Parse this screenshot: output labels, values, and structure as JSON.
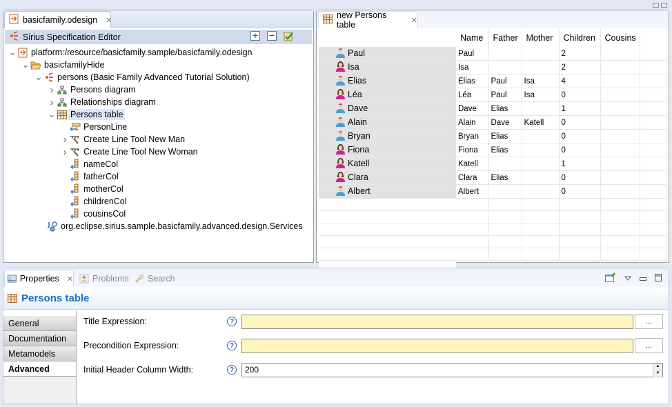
{
  "left_editor": {
    "tab_label": "basicfamily.odesign",
    "header_title": "Sirius Specification Editor",
    "tools": [
      {
        "name": "expand-all",
        "icon": "plus-box-icon"
      },
      {
        "name": "collapse-all",
        "icon": "minus-box-icon"
      },
      {
        "name": "validate",
        "icon": "validate-check-icon"
      }
    ],
    "tree": [
      {
        "label": "platform:/resource/basicfamily.sample/basicfamily.odesign",
        "level": 0,
        "twisty": "expanded",
        "icon": "odesign-file-icon"
      },
      {
        "label": "basicfamilyHide",
        "level": 1,
        "twisty": "expanded",
        "icon": "folder-open-icon"
      },
      {
        "label": "persons (Basic Family Advanced Tutorial Solution)",
        "level": 2,
        "twisty": "expanded",
        "icon": "sirius-viewpoint-icon"
      },
      {
        "label": "Persons diagram",
        "level": 3,
        "twisty": "collapsed",
        "icon": "diagram-icon"
      },
      {
        "label": "Relationships diagram",
        "level": 3,
        "twisty": "collapsed",
        "icon": "diagram-icon"
      },
      {
        "label": "Persons table",
        "level": 3,
        "twisty": "expanded",
        "icon": "table-icon",
        "selected": true
      },
      {
        "label": "PersonLine",
        "level": 4,
        "twisty": "none",
        "icon": "line-mapping-icon"
      },
      {
        "label": "Create Line Tool New Man",
        "level": 4,
        "twisty": "collapsed",
        "icon": "create-tool-icon"
      },
      {
        "label": "Create Line Tool New Woman",
        "level": 4,
        "twisty": "collapsed",
        "icon": "create-tool-icon"
      },
      {
        "label": "nameCol",
        "level": 4,
        "twisty": "none",
        "icon": "column-mapping-icon"
      },
      {
        "label": "fatherCol",
        "level": 4,
        "twisty": "none",
        "icon": "column-mapping-icon"
      },
      {
        "label": "motherCol",
        "level": 4,
        "twisty": "none",
        "icon": "column-mapping-icon"
      },
      {
        "label": "childrenCol",
        "level": 4,
        "twisty": "none",
        "icon": "column-mapping-icon"
      },
      {
        "label": "cousinsCol",
        "level": 4,
        "twisty": "none",
        "icon": "column-mapping-icon"
      },
      {
        "label": "org.eclipse.sirius.sample.basicfamily.advanced.design.Services",
        "level": 3,
        "twisty": "none",
        "icon": "java-extension-icon",
        "outdent": true
      }
    ]
  },
  "table_editor": {
    "tab_label": "new Persons table",
    "columns": [
      "Name",
      "Father",
      "Mother",
      "Children",
      "Cousins"
    ],
    "rows": [
      {
        "header": "Paul",
        "gender": "male",
        "cells": [
          "Paul",
          "",
          "",
          "2",
          ""
        ]
      },
      {
        "header": "Isa",
        "gender": "female",
        "cells": [
          "Isa",
          "",
          "",
          "2",
          ""
        ]
      },
      {
        "header": "Elias",
        "gender": "male",
        "cells": [
          "Elias",
          "Paul",
          "Isa",
          "4",
          ""
        ]
      },
      {
        "header": "Léa",
        "gender": "female",
        "cells": [
          "Léa",
          "Paul",
          "Isa",
          "0",
          ""
        ]
      },
      {
        "header": "Dave",
        "gender": "male",
        "cells": [
          "Dave",
          "Elias",
          "",
          "1",
          ""
        ]
      },
      {
        "header": "Alain",
        "gender": "male",
        "cells": [
          "Alain",
          "Dave",
          "Katell",
          "0",
          ""
        ]
      },
      {
        "header": "Bryan",
        "gender": "male",
        "cells": [
          "Bryan",
          "Elias",
          "",
          "0",
          ""
        ]
      },
      {
        "header": "Fiona",
        "gender": "female",
        "cells": [
          "Fiona",
          "Elias",
          "",
          "0",
          ""
        ]
      },
      {
        "header": "Katell",
        "gender": "female",
        "cells": [
          "Katell",
          "",
          "",
          "1",
          ""
        ]
      },
      {
        "header": "Clara",
        "gender": "female",
        "cells": [
          "Clara",
          "Elias",
          "",
          "0",
          ""
        ]
      },
      {
        "header": "Albert",
        "gender": "male",
        "cells": [
          "Albert",
          "",
          "",
          "0",
          ""
        ]
      }
    ],
    "colors": {
      "male": "#4a9fd8",
      "female": "#d0208a",
      "row_header_bg": "#e2e2e2"
    }
  },
  "bottom_views": {
    "tabs": [
      {
        "label": "Properties",
        "active": true,
        "icon": "properties-icon"
      },
      {
        "label": "Problems",
        "active": false,
        "icon": "problems-icon"
      },
      {
        "label": "Search",
        "active": false,
        "icon": "search-icon"
      }
    ],
    "properties": {
      "title": "Persons table",
      "section_tabs": [
        "General",
        "Documentation",
        "Metamodels",
        "Advanced"
      ],
      "active_section": "Advanced",
      "fields": {
        "title_expression": {
          "label": "Title Expression:",
          "value": "",
          "browse_label": "..."
        },
        "precondition_expression": {
          "label": "Precondition Expression:",
          "value": "",
          "browse_label": "..."
        },
        "initial_header_column_width": {
          "label": "Initial Header Column Width:",
          "value": "200"
        }
      },
      "help_glyph": "?"
    }
  },
  "colors": {
    "accent": "#1b6ec2",
    "expression_bg": "#fff5bf",
    "selection_bg": "#d9e8fb"
  }
}
